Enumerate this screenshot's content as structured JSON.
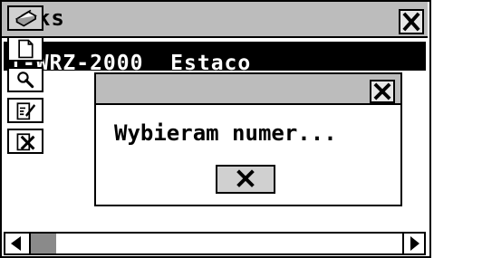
{
  "window": {
    "title": "Faks",
    "close_icon": "close-icon"
  },
  "list": {
    "rows": [
      {
        "text": "1-WRZ-2000  Estaco"
      }
    ]
  },
  "toolbar": {
    "icons": [
      "printer-icon",
      "new-document-icon",
      "search-icon",
      "edit-icon",
      "delete-icon"
    ]
  },
  "dialog": {
    "message": "Wybieram numer...",
    "close_icon": "close-icon",
    "cancel_icon": "close-icon"
  },
  "scrollbar": {
    "left_arrow_icon": "arrow-left-icon",
    "right_arrow_icon": "arrow-right-icon",
    "position": 0
  }
}
